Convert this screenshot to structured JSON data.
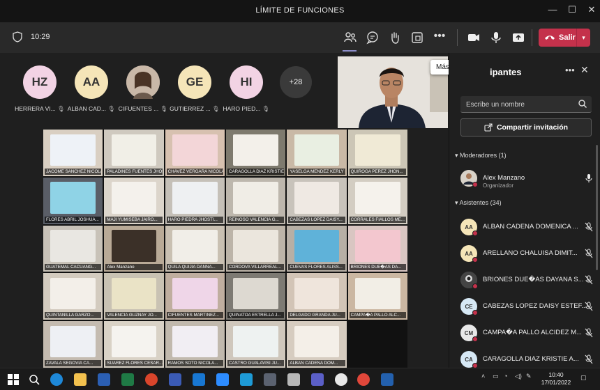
{
  "window": {
    "title": "LÍMITE DE FUNCIONES"
  },
  "toolbar": {
    "time": "10:29",
    "leave_label": "Salir"
  },
  "tooltip": "Más acciones",
  "avatars": [
    {
      "initials": "HZ",
      "name": "HERRERA VI...",
      "color": "#f2d3e4"
    },
    {
      "initials": "AA",
      "name": "ALBAN CAD...",
      "color": "#f5e5b8"
    },
    {
      "initials": "",
      "name": "CIFUENTES ...",
      "color": "#b8a79a"
    },
    {
      "initials": "GE",
      "name": "GUTIERREZ ...",
      "color": "#f5e5b8"
    },
    {
      "initials": "HI",
      "name": "HARO PIED...",
      "color": "#f2d3e4"
    }
  ],
  "more_count": "+28",
  "grid_tiles": [
    {
      "label": "JACOME SANCHEZ NICOLAS ...",
      "bg": "#d9cfc2",
      "poster": "#eef2f7"
    },
    {
      "label": "PALADINES FUENTES JHOSS...",
      "bg": "#cfc9bf",
      "poster": "#f1efe7"
    },
    {
      "label": "CHAVEZ VERGARA NICOLAS ...",
      "bg": "#d7c1b0",
      "poster": "#f3d6d8"
    },
    {
      "label": "CARAGOLLA DIAZ KRISTIE A...",
      "bg": "#7e7a6e",
      "poster": "#f3f0ea"
    },
    {
      "label": "YASELGA MENDEZ KERLY M...",
      "bg": "#c9b9a6",
      "poster": "#e9efe2"
    },
    {
      "label": "QUIROGA PEREZ JHON...",
      "bg": "#ccc6b6",
      "poster": "#f0ead6"
    },
    {
      "label": "FLORES ABRIL JOSHUA...",
      "bg": "#5a5e67",
      "poster": "#8fd3e6"
    },
    {
      "label": "MAJI YUMISEBA JAIRO...",
      "bg": "#dcd5cb",
      "poster": "#f4f1ec"
    },
    {
      "label": "HARO PIEDRA JHOSTI...",
      "bg": "#c5c0b8",
      "poster": "#eef0f2"
    },
    {
      "label": "REINOSO VALENCIA G...",
      "bg": "#bdb7ad",
      "poster": "#f0ede6"
    },
    {
      "label": "CABEZAS LOPEZ DAISY...",
      "bg": "#c8c3bb",
      "poster": "#efe9e3"
    },
    {
      "label": "CORRALES FIALLOS ME...",
      "bg": "#d3cdc2",
      "poster": "#f5f2ec"
    },
    {
      "label": "GUATEMAL CACUANG...",
      "bg": "#c8c2b8",
      "poster": "#e9e7e2"
    },
    {
      "label": "Alex Manzano",
      "bg": "#b9aa97",
      "poster": "#3b3028"
    },
    {
      "label": "QUILA QUIJIA DANNA...",
      "bg": "#c9c0b2",
      "poster": "#f1eee8"
    },
    {
      "label": "CORDOVA VILLARREAL...",
      "bg": "#bcb4a8",
      "poster": "#ebe6dd"
    },
    {
      "label": "CUEVAS FLORES ALISS...",
      "bg": "#b7afa5",
      "poster": "#5fb2d9"
    },
    {
      "label": "BRIONES DUE�AS DA...",
      "bg": "#d9c6c2",
      "poster": "#f3c7cf"
    },
    {
      "label": "QUINTANILLA GARZO...",
      "bg": "#d3cbbf",
      "poster": "#f3efe9"
    },
    {
      "label": "VALENCIA GUZNAY JO...",
      "bg": "#c9c2b3",
      "poster": "#eae3c6"
    },
    {
      "label": "CIFUENTES MARTINEZ...",
      "bg": "#bfae9f",
      "poster": "#efd6e8"
    },
    {
      "label": "QUINATOA ESTRELLA J...",
      "bg": "#7d7a73",
      "poster": "#ddd9d1"
    },
    {
      "label": "DELGADO GRANDA JU...",
      "bg": "#d2c4b6",
      "poster": "#efe5dc"
    },
    {
      "label": "CAMPA�A PALLO ALC...",
      "bg": "#cbb7a2",
      "poster": "#f2eee6"
    },
    {
      "label": "ZAVALA SEGOVIA CA...",
      "bg": "#c4bbb0",
      "poster": "#eef0f4"
    },
    {
      "label": "SUAREZ FLORES CESAR...",
      "bg": "#d9d2c6",
      "poster": "#f5f3ef"
    },
    {
      "label": "RAMOS SOTO NICOLA...",
      "bg": "#c1b9ad",
      "poster": "#f1eef3"
    },
    {
      "label": "CASTRO GUALAVISI JU...",
      "bg": "#cfc7bc",
      "poster": "#eef2f1"
    },
    {
      "label": "ALBAN CADENA DOM...",
      "bg": "#d6ccc0",
      "poster": "#f4efe8"
    }
  ],
  "panel": {
    "title": "ipantes",
    "search_placeholder": "Escribe un nombre",
    "share_label": "Compartir invitación",
    "moderators_header": "Moderadores (1)",
    "moderator": {
      "name": "Alex Manzano",
      "role": "Organizador"
    },
    "attendees_header": "Asistentes (34)",
    "attendees": [
      {
        "initials": "AA",
        "name": "ALBAN CADENA DOMENICA ...",
        "color": "#f5e5b8"
      },
      {
        "initials": "AA",
        "name": "ARELLANO CHALUISA DIMIT...",
        "color": "#f5e5b8"
      },
      {
        "initials": "",
        "name": "BRIONES DUE�AS DAYANA S...",
        "color": "#555555"
      },
      {
        "initials": "CE",
        "name": "CABEZAS LOPEZ DAISY ESTEF...",
        "color": "#d6e8f5"
      },
      {
        "initials": "CM",
        "name": "CAMPA�A PALLO ALCIDEZ M...",
        "color": "#e8e8e8"
      },
      {
        "initials": "CA",
        "name": "CARAGOLLA DIAZ KRISTIE A...",
        "color": "#d6e8f5"
      }
    ]
  },
  "taskbar": {
    "time": "10:40",
    "date": "17/01/2022"
  }
}
